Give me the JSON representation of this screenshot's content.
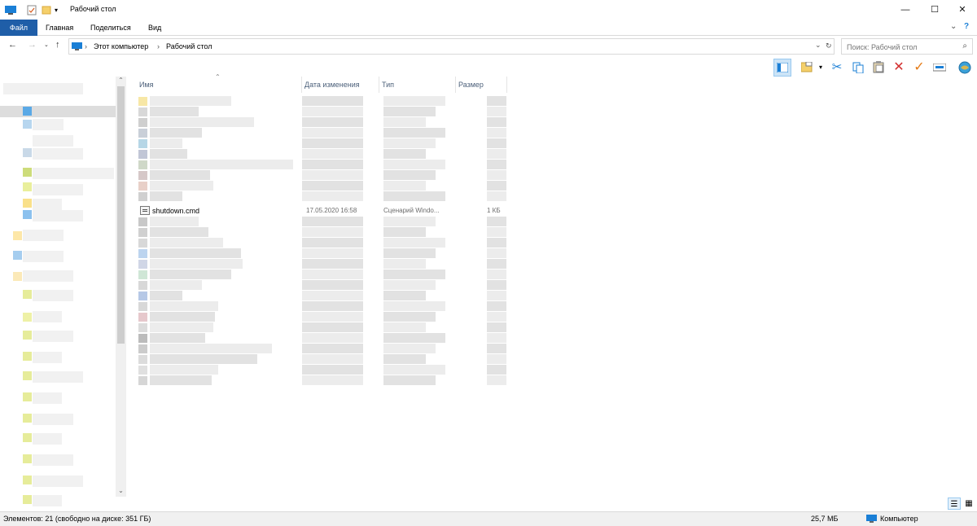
{
  "window": {
    "title": "Рабочий стол",
    "controls": {
      "minimize": "—",
      "maximize": "☐",
      "close": "✕"
    }
  },
  "ribbon": {
    "tabs": [
      "Файл",
      "Главная",
      "Поделиться",
      "Вид"
    ],
    "expand_glyph": "⌄",
    "help_glyph": "?"
  },
  "address": {
    "crumbs": [
      "Этот компьютер",
      "Рабочий стол"
    ],
    "dropdown_glyph": "⌄",
    "refresh_glyph": "↻"
  },
  "search": {
    "placeholder": "Поиск: Рабочий стол",
    "icon": "search-icon"
  },
  "columns": [
    "Имя",
    "Дата изменения",
    "Тип",
    "Размер"
  ],
  "file": {
    "name": "shutdown.cmd",
    "date": "17.05.2020 16:58",
    "type": "Сценарий Windo...",
    "size": "1 КБ"
  },
  "status": {
    "left": "Элементов: 21 (свободно на диске: 351 ГБ)",
    "size": "25,7 МБ",
    "location": "Компьютер"
  },
  "colors": {
    "file_tab": "#1f5ea8",
    "accent_active": "#cce4f7",
    "delete_red": "#d32f2f",
    "check_orange": "#e57b17"
  }
}
